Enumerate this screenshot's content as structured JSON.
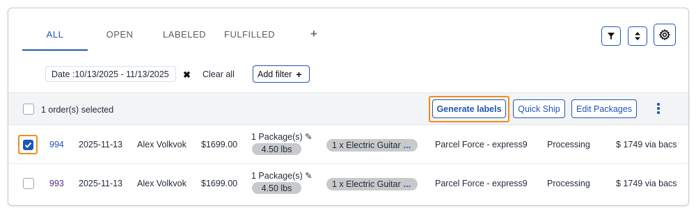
{
  "tabs": [
    {
      "label": "ALL",
      "active": true
    },
    {
      "label": "OPEN",
      "active": false
    },
    {
      "label": "LABELED",
      "active": false
    },
    {
      "label": "FULFILLED",
      "active": false
    }
  ],
  "tab_add_label": "+",
  "toolbar_icons": [
    "filter-icon",
    "sort-icon",
    "gear-icon"
  ],
  "filters": {
    "date_chip": "Date :10/13/2025 - 11/13/2025",
    "clear_label": "Clear all",
    "add_filter_label": "Add filter"
  },
  "action_bar": {
    "selected_text": "1 order(s) selected",
    "generate_labels": "Generate labels",
    "quick_ship": "Quick Ship",
    "edit_packages": "Edit Packages"
  },
  "orders": [
    {
      "checked": true,
      "order_no": "994",
      "date": "2025-11-13",
      "customer": "Alex Volkvok",
      "amount": "$1699.00",
      "packages": "1 Package(s)",
      "weight": "4.50 lbs",
      "items": "1 x Electric Guitar",
      "items_more": "...",
      "carrier": "Parcel Force - express9",
      "status": "Processing",
      "payment": "$ 1749 via bacs"
    },
    {
      "checked": false,
      "order_no": "993",
      "date": "2025-11-13",
      "customer": "Alex Volkvok",
      "amount": "$1699.00",
      "packages": "1 Package(s)",
      "weight": "4.50 lbs",
      "items": "1 x Electric Guitar",
      "items_more": "...",
      "carrier": "Parcel Force - express9",
      "status": "Processing",
      "payment": "$ 1749 via bacs"
    }
  ],
  "colors": {
    "accent": "#1f56b4",
    "highlight": "#f28b1e",
    "pill": "#c8c9cb"
  }
}
